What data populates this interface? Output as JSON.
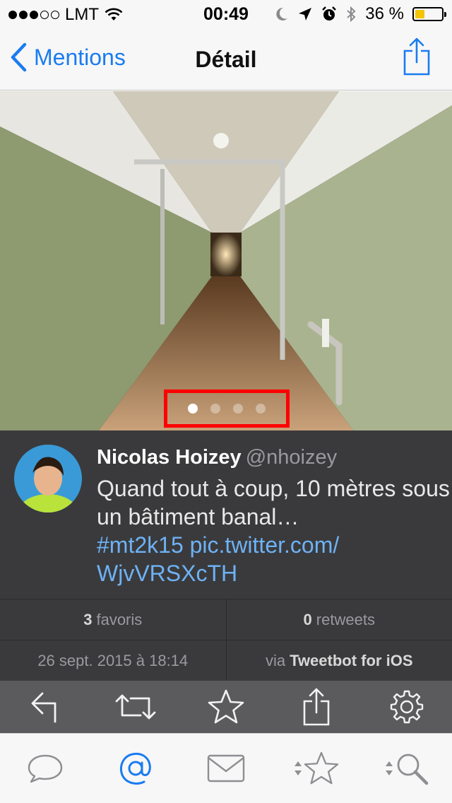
{
  "status_bar": {
    "carrier": "LMT",
    "time": "00:49",
    "battery_percent": "36 %",
    "battery_level": 0.36,
    "signal_bars": 3,
    "signal_total": 5,
    "icons": [
      "wifi-icon",
      "moon-icon",
      "location-arrow-icon",
      "alarm-icon",
      "bluetooth-icon"
    ]
  },
  "nav": {
    "back_label": "Mentions",
    "title": "Détail",
    "share_icon": "share-icon"
  },
  "photo": {
    "page_count": 4,
    "current_page": 1,
    "highlight_color": "#ff0000"
  },
  "tweet": {
    "name": "Nicolas Hoizey",
    "handle": "@nhoizey",
    "text": "Quand tout à coup, 10 mètres sous un bâtiment banal…",
    "hashtag": "#mt2k15",
    "link": "pic.twitter.com/WjvVRSXcTH",
    "link_line1": "pic.twitter.com/",
    "link_line2": "WjvVRSXcTH"
  },
  "stats": {
    "favorites_count": "3",
    "favorites_label": "favoris",
    "retweets_count": "0",
    "retweets_label": "retweets",
    "date": "26 sept. 2015 à 18:14",
    "via_prefix": "via",
    "client": "Tweetbot for iOS"
  },
  "actions": [
    "reply-icon",
    "retweet-icon",
    "favorite-icon",
    "share-icon",
    "settings-icon"
  ],
  "tabs": [
    {
      "icon": "timeline-icon",
      "active": false
    },
    {
      "icon": "mentions-icon",
      "active": true
    },
    {
      "icon": "messages-icon",
      "active": false
    },
    {
      "icon": "favorites-icon",
      "active": false
    },
    {
      "icon": "search-icon",
      "active": false
    }
  ],
  "colors": {
    "accent": "#1a7cf0",
    "link": "#6eb2f5",
    "tweet_background": "#3a3a3c",
    "toolbar_background": "#5b5b5e"
  }
}
